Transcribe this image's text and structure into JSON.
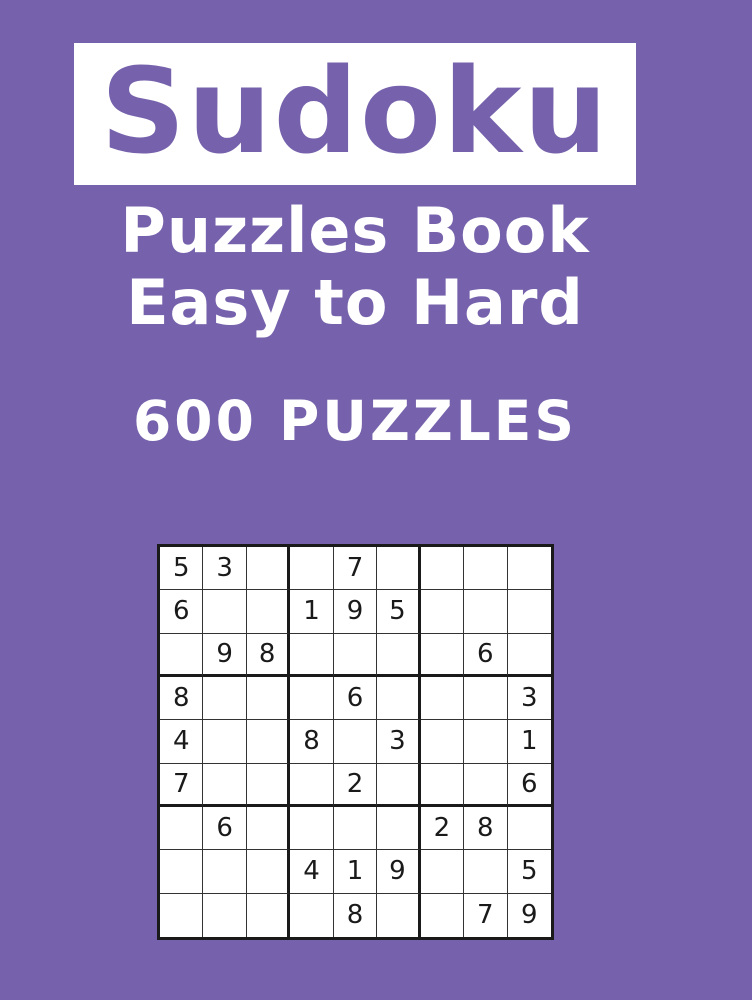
{
  "cover": {
    "title": "Sudoku",
    "subtitle_line1": "Puzzles Book",
    "subtitle_line2": "Easy to Hard",
    "puzzle_count": "600 PUZZLES"
  },
  "colors": {
    "background": "#7662ac",
    "title_box": "#ffffff",
    "text": "#ffffff",
    "grid_line": "#1a1a1a"
  },
  "sudoku_grid": [
    [
      "5",
      "3",
      "",
      "",
      "7",
      "",
      "",
      "",
      ""
    ],
    [
      "6",
      "",
      "",
      "1",
      "9",
      "5",
      "",
      "",
      ""
    ],
    [
      "",
      "9",
      "8",
      "",
      "",
      "",
      "",
      "6",
      ""
    ],
    [
      "8",
      "",
      "",
      "",
      "6",
      "",
      "",
      "",
      "3"
    ],
    [
      "4",
      "",
      "",
      "8",
      "",
      "3",
      "",
      "",
      "1"
    ],
    [
      "7",
      "",
      "",
      "",
      "2",
      "",
      "",
      "",
      "6"
    ],
    [
      "",
      "6",
      "",
      "",
      "",
      "",
      "2",
      "8",
      ""
    ],
    [
      "",
      "",
      "",
      "4",
      "1",
      "9",
      "",
      "",
      "5"
    ],
    [
      "",
      "",
      "",
      "",
      "8",
      "",
      "",
      "7",
      "9"
    ]
  ]
}
